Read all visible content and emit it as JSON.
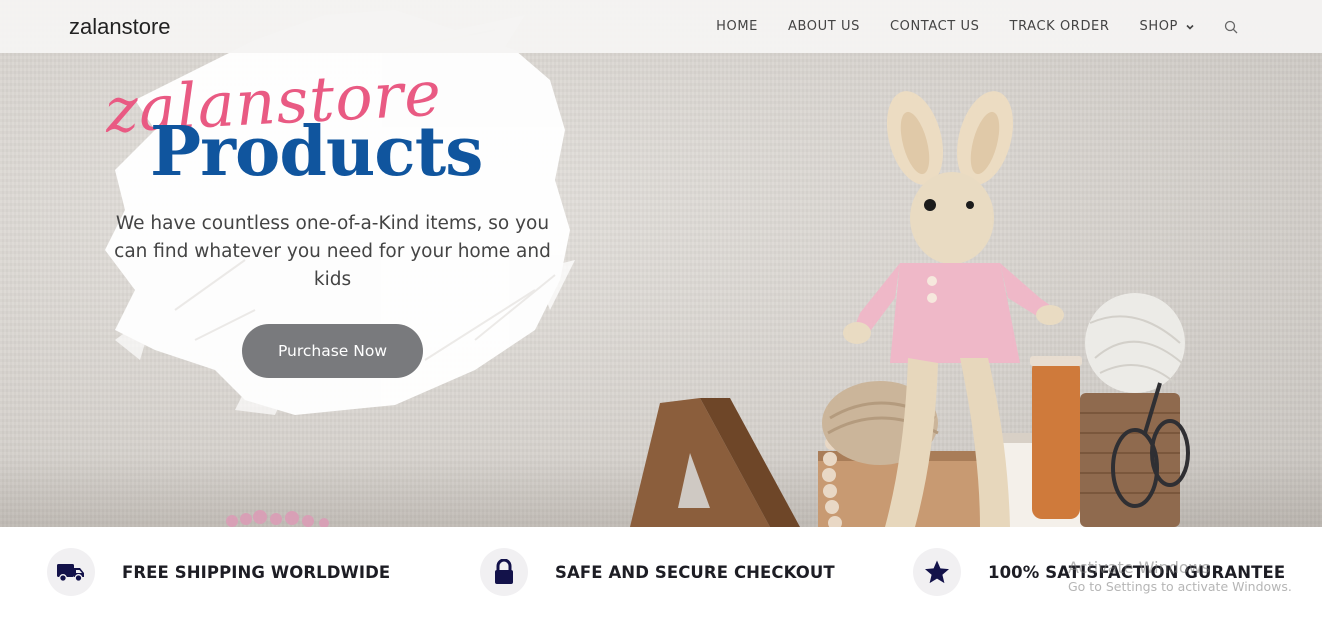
{
  "header": {
    "logo": "zalanstore",
    "nav": [
      {
        "label": "HOME"
      },
      {
        "label": "ABOUT US"
      },
      {
        "label": "CONTACT US"
      },
      {
        "label": "TRACK ORDER"
      },
      {
        "label": "SHOP"
      }
    ],
    "search_icon": "search-icon"
  },
  "hero": {
    "script_title": "zalanstore",
    "title": "Products",
    "description": "We have countless one-of-a-Kind items, so you can find whatever you need for your home and kids",
    "cta_label": "Purchase Now"
  },
  "features": [
    {
      "icon": "truck-icon",
      "label": "FREE SHIPPING WORLDWIDE"
    },
    {
      "icon": "lock-icon",
      "label": "SAFE AND SECURE CHECKOUT"
    },
    {
      "icon": "star-icon",
      "label": "100% SATISFACTION GURANTEE"
    }
  ],
  "watermark": {
    "title": "Activate Windows",
    "subtitle": "Go to Settings to activate Windows."
  },
  "colors": {
    "script": "#e95a83",
    "title": "#10559e",
    "cta": "#797a7d",
    "icon": "#13124a"
  }
}
